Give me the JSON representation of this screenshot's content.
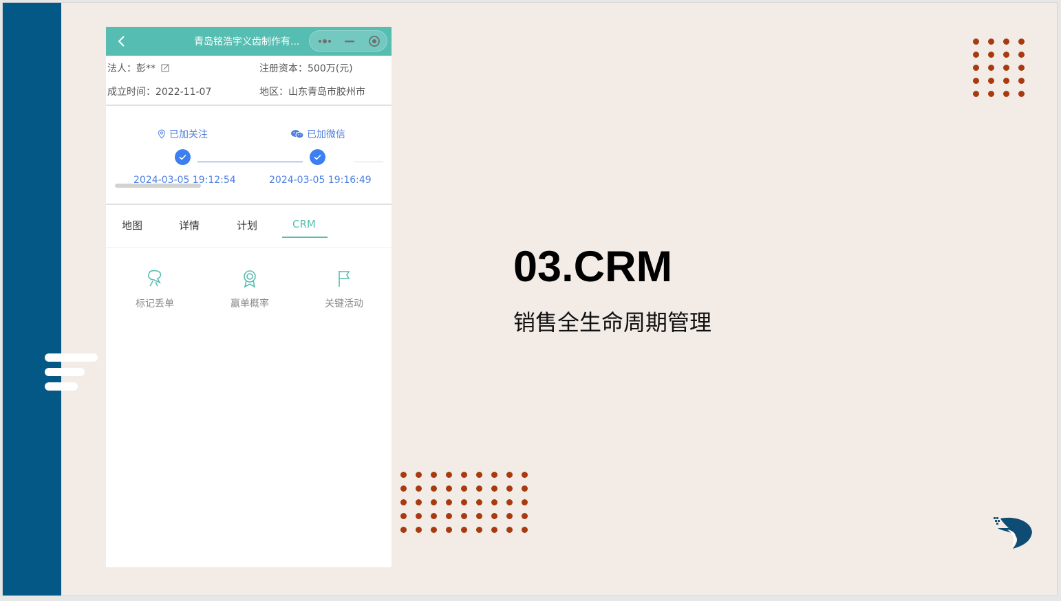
{
  "colors": {
    "side_band": "#045886",
    "slide_bg": "#f2ebe6",
    "teal_accent": "#55bdb1",
    "blue_accent": "#3c7ff0",
    "dot_color": "#a83a10"
  },
  "phone": {
    "header": {
      "back_icon": "chevron-left-icon",
      "title": "青岛铭浩宇义齿制作有...",
      "capsule_icons": [
        "more-icon",
        "minimize-icon",
        "target-icon"
      ]
    },
    "company": {
      "legal_person": "法人：彭**",
      "registered_capital": "注册资本：500万(元)",
      "founded": "成立时间：2022-11-07",
      "region": "地区：山东青岛市胶州市"
    },
    "progress": {
      "steps": [
        {
          "label": "已加关注",
          "icon": "location-pin-icon",
          "time": "2024-03-05 19:12:54"
        },
        {
          "label": "已加微信",
          "icon": "wechat-icon",
          "time": "2024-03-05 19:16:49"
        }
      ]
    },
    "tabs": [
      {
        "label": "地图",
        "active": false
      },
      {
        "label": "详情",
        "active": false
      },
      {
        "label": "计划",
        "active": false
      },
      {
        "label": "CRM",
        "active": true
      }
    ],
    "actions": [
      {
        "label": "标记丢单",
        "icon": "lost-deal-icon"
      },
      {
        "label": "赢单概率",
        "icon": "award-icon"
      },
      {
        "label": "关键活动",
        "icon": "flag-icon"
      }
    ]
  },
  "slide": {
    "heading": "03.CRM",
    "subheading": "销售全生命周期管理"
  }
}
